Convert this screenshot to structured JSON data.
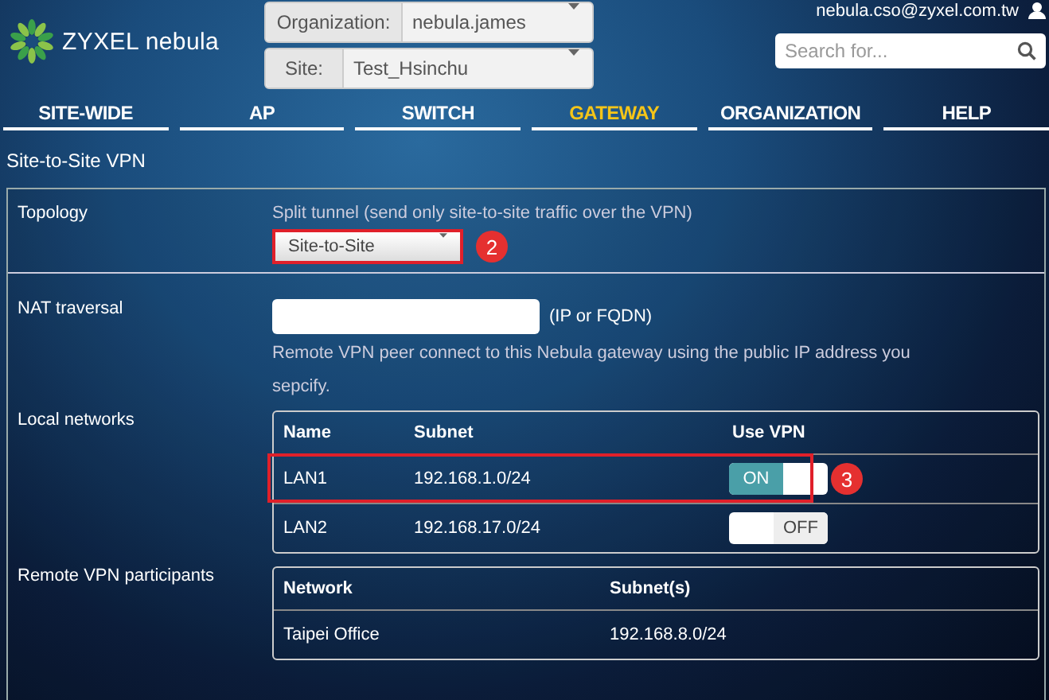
{
  "header": {
    "brand": "ZYXEL nebula",
    "organization": {
      "label": "Organization:",
      "value": "nebula.james"
    },
    "site": {
      "label": "Site:",
      "value": "Test_Hsinchu"
    },
    "account": "nebula.cso@zyxel.com.tw",
    "search": {
      "placeholder": "Search for..."
    }
  },
  "tabs": [
    {
      "label": "SITE-WIDE",
      "selected": false
    },
    {
      "label": "AP",
      "selected": false
    },
    {
      "label": "SWITCH",
      "selected": false
    },
    {
      "label": "GATEWAY",
      "selected": true
    },
    {
      "label": "ORGANIZATION",
      "selected": false
    },
    {
      "label": "HELP",
      "selected": false
    }
  ],
  "page_title": "Site-to-Site VPN",
  "topology": {
    "label": "Topology",
    "description": "Split tunnel (send only site-to-site traffic over the VPN)",
    "value": "Site-to-Site",
    "callout": "2"
  },
  "nat_traversal": {
    "label": "NAT traversal",
    "unit": "(IP or FQDN)",
    "help": "Remote VPN peer connect to this Nebula gateway using the public IP address you sepcify."
  },
  "local_networks": {
    "label": "Local networks",
    "columns": [
      "Name",
      "Subnet",
      "Use VPN"
    ],
    "callout": "3",
    "rows": [
      {
        "name": "LAN1",
        "subnet": "192.168.1.0/24",
        "toggle": "ON",
        "on": true,
        "highlighted": true
      },
      {
        "name": "LAN2",
        "subnet": "192.168.17.0/24",
        "toggle": "OFF",
        "on": false,
        "highlighted": false
      }
    ]
  },
  "remote_vpn": {
    "label": "Remote VPN participants",
    "columns": [
      "Network",
      "Subnet(s)"
    ],
    "rows": [
      {
        "network": "Taipei Office",
        "subnet": "192.168.8.0/24"
      }
    ]
  }
}
